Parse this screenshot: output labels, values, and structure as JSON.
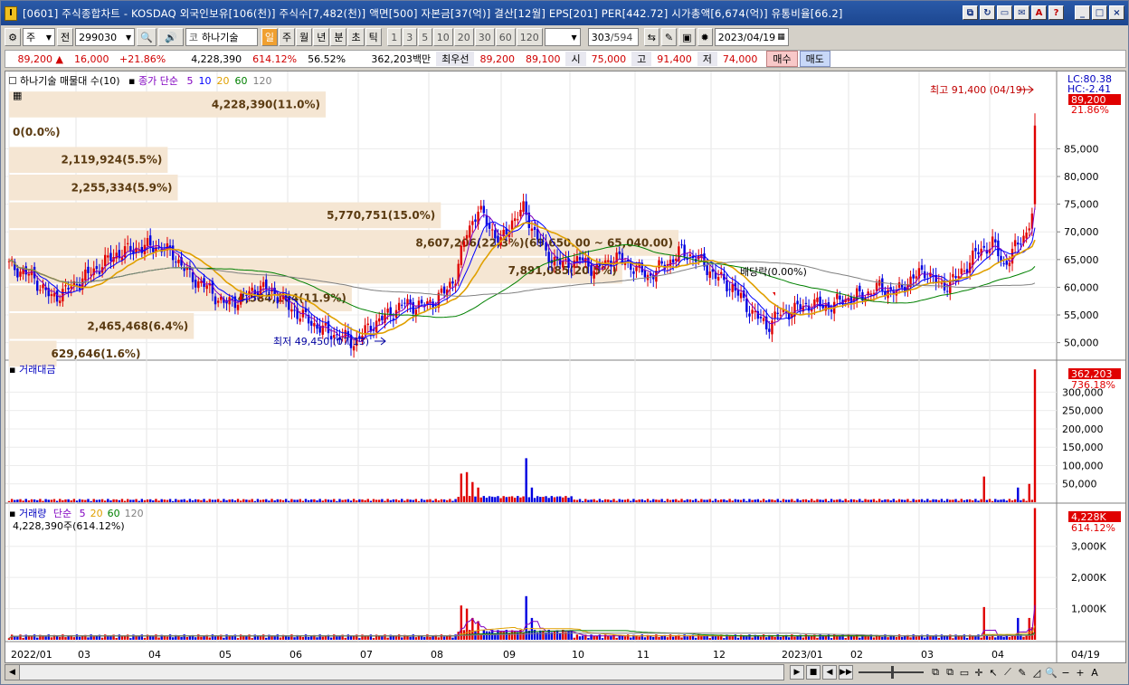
{
  "window": {
    "title": "[0601] 주식종합차트 - KOSDAQ 외국인보유[106(천)] 주식수[7,482(천)] 액면[500] 자본금[37(억)] 결산[12월] EPS[201] PER[442.72] 시가총액[6,674(억)] 유통비율[66.2]"
  },
  "title_buttons": [
    "⧉",
    "↻",
    "▭",
    "✉",
    "A",
    "?",
    "_",
    "□",
    "×"
  ],
  "toolbar": {
    "type_select": "주",
    "prev_label": "전",
    "code": "299030",
    "stock_name": "하나기술",
    "periods": [
      "일",
      "주",
      "월",
      "년",
      "분",
      "초",
      "틱"
    ],
    "active_period": "일",
    "intervals": [
      "1",
      "3",
      "5",
      "10",
      "20",
      "30",
      "60",
      "120"
    ],
    "count": "303",
    "total": "/594",
    "date": "2023/04/19"
  },
  "quote": {
    "price": "89,200",
    "change": "16,000",
    "change_pct": "+21.86%",
    "volume": "4,228,390",
    "vol_ratio": "614.12%",
    "turnover": "56.52%",
    "amount": "362,203백만",
    "bid_label": "최우선",
    "bid": "89,200",
    "ask": "89,100",
    "open_label": "시",
    "open": "75,000",
    "high_label": "고",
    "high": "91,400",
    "low_label": "저",
    "low": "74,000",
    "buy_label": "매수",
    "sell_label": "매도"
  },
  "price_panel": {
    "legend_title": "하나기술 매물대 수(10)",
    "ma_label": "종가 단순",
    "ma_periods": [
      "5",
      "10",
      "20",
      "60",
      "120"
    ],
    "ma_colors": [
      "#8000c0",
      "#0000ff",
      "#e0a000",
      "#008000",
      "#808080"
    ],
    "lc": "LC:80.38",
    "hc": "HC:-2.41",
    "last_price": "89,200",
    "last_pct": "21.86%",
    "high_note": "최고 91,400 (04/19)",
    "low_note": "최저 49,450 (07/13)",
    "dividend_note": "배당락(0.00%)",
    "y_ticks": [
      "85,000",
      "80,000",
      "75,000",
      "70,000",
      "65,000",
      "60,000",
      "55,000",
      "50,000"
    ],
    "y_range": [
      47000,
      97000
    ],
    "volume_profile": [
      {
        "price": 93000,
        "label": "4,228,390(11.0%)",
        "frac": 0.473
      },
      {
        "price": 88000,
        "label": "0(0.0%)",
        "frac": 0.0
      },
      {
        "price": 83000,
        "label": "2,119,924(5.5%)",
        "frac": 0.237
      },
      {
        "price": 78000,
        "label": "2,255,334(5.9%)",
        "frac": 0.252
      },
      {
        "price": 73000,
        "label": "5,770,751(15.0%)",
        "frac": 0.645
      },
      {
        "price": 68000,
        "label": "8,607,206(22.3%)(69,650.00 ~ 65,040.00)",
        "frac": 1.0
      },
      {
        "price": 63000,
        "label": "7,891,085(20.5%)",
        "frac": 0.916
      },
      {
        "price": 58000,
        "label": "4,584,164(11.9%)",
        "frac": 0.512
      },
      {
        "price": 53000,
        "label": "2,465,468(6.4%)",
        "frac": 0.276
      },
      {
        "price": 48000,
        "label": "629,646(1.6%)",
        "frac": 0.071
      }
    ]
  },
  "amount_panel": {
    "title": "거래대금",
    "last": "362,203",
    "last_pct": "736.18%",
    "y_ticks": [
      "300,000",
      "250,000",
      "200,000",
      "150,000",
      "100,000",
      "50,000"
    ],
    "y_max": 380000
  },
  "volume_panel": {
    "title": "거래량",
    "ma_label": "단순",
    "ma_periods": [
      "5",
      "20",
      "60",
      "120"
    ],
    "subtitle": "4,228,390주(614.12%)",
    "last": "4,228K",
    "last_pct": "614.12%",
    "y_ticks": [
      "3,000K",
      "2,000K",
      "1,000K"
    ],
    "y_max": 4300
  },
  "x_axis": {
    "labels": [
      "2022/01",
      "03",
      "04",
      "05",
      "06",
      "07",
      "08",
      "09",
      "10",
      "11",
      "12",
      "2023/01",
      "02",
      "03",
      "04"
    ],
    "last_date": "04/19"
  },
  "chart_data": {
    "type": "candlestick",
    "title": "하나기술",
    "xlabel": "",
    "ylabel": "",
    "ylim": [
      47000,
      97000
    ],
    "close_anchors": [
      [
        0,
        64000
      ],
      [
        8,
        62000
      ],
      [
        15,
        58000
      ],
      [
        22,
        60000
      ],
      [
        30,
        63000
      ],
      [
        38,
        66000
      ],
      [
        45,
        67000
      ],
      [
        52,
        67500
      ],
      [
        58,
        66000
      ],
      [
        64,
        62000
      ],
      [
        70,
        60000
      ],
      [
        76,
        57000
      ],
      [
        82,
        58000
      ],
      [
        88,
        60000
      ],
      [
        94,
        59000
      ],
      [
        100,
        56000
      ],
      [
        106,
        54000
      ],
      [
        112,
        52000
      ],
      [
        118,
        51000
      ],
      [
        122,
        50000
      ],
      [
        128,
        53000
      ],
      [
        134,
        55000
      ],
      [
        140,
        57000
      ],
      [
        146,
        56500
      ],
      [
        150,
        57500
      ],
      [
        154,
        59000
      ],
      [
        158,
        62000
      ],
      [
        162,
        70000
      ],
      [
        166,
        74000
      ],
      [
        170,
        71000
      ],
      [
        174,
        68000
      ],
      [
        178,
        72000
      ],
      [
        182,
        74000
      ],
      [
        186,
        70000
      ],
      [
        190,
        66000
      ],
      [
        196,
        64000
      ],
      [
        202,
        65000
      ],
      [
        208,
        63000
      ],
      [
        214,
        65500
      ],
      [
        220,
        64000
      ],
      [
        226,
        62000
      ],
      [
        232,
        64000
      ],
      [
        238,
        66500
      ],
      [
        244,
        65000
      ],
      [
        250,
        62000
      ],
      [
        256,
        60000
      ],
      [
        262,
        56000
      ],
      [
        268,
        53000
      ],
      [
        272,
        55000
      ],
      [
        278,
        56000
      ],
      [
        284,
        57000
      ],
      [
        290,
        56500
      ],
      [
        296,
        58000
      ],
      [
        302,
        58500
      ],
      [
        308,
        60000
      ],
      [
        314,
        59000
      ],
      [
        318,
        61000
      ],
      [
        324,
        63000
      ],
      [
        330,
        60000
      ],
      [
        336,
        62000
      ],
      [
        342,
        66000
      ],
      [
        348,
        68000
      ],
      [
        352,
        64000
      ],
      [
        356,
        67000
      ],
      [
        360,
        70000
      ],
      [
        362,
        73200
      ],
      [
        363,
        89200
      ]
    ],
    "amount_spikes": [
      [
        160,
        78000
      ],
      [
        162,
        82000
      ],
      [
        164,
        55000
      ],
      [
        166,
        40000
      ],
      [
        183,
        120000
      ],
      [
        185,
        40000
      ],
      [
        345,
        70000
      ],
      [
        357,
        40000
      ],
      [
        361,
        50000
      ],
      [
        363,
        362203
      ]
    ],
    "volume_spikes": [
      [
        160,
        1100
      ],
      [
        162,
        1000
      ],
      [
        164,
        700
      ],
      [
        166,
        600
      ],
      [
        183,
        1400
      ],
      [
        185,
        700
      ],
      [
        345,
        1050
      ],
      [
        357,
        700
      ],
      [
        361,
        700
      ],
      [
        362,
        400
      ],
      [
        363,
        4228
      ]
    ]
  }
}
